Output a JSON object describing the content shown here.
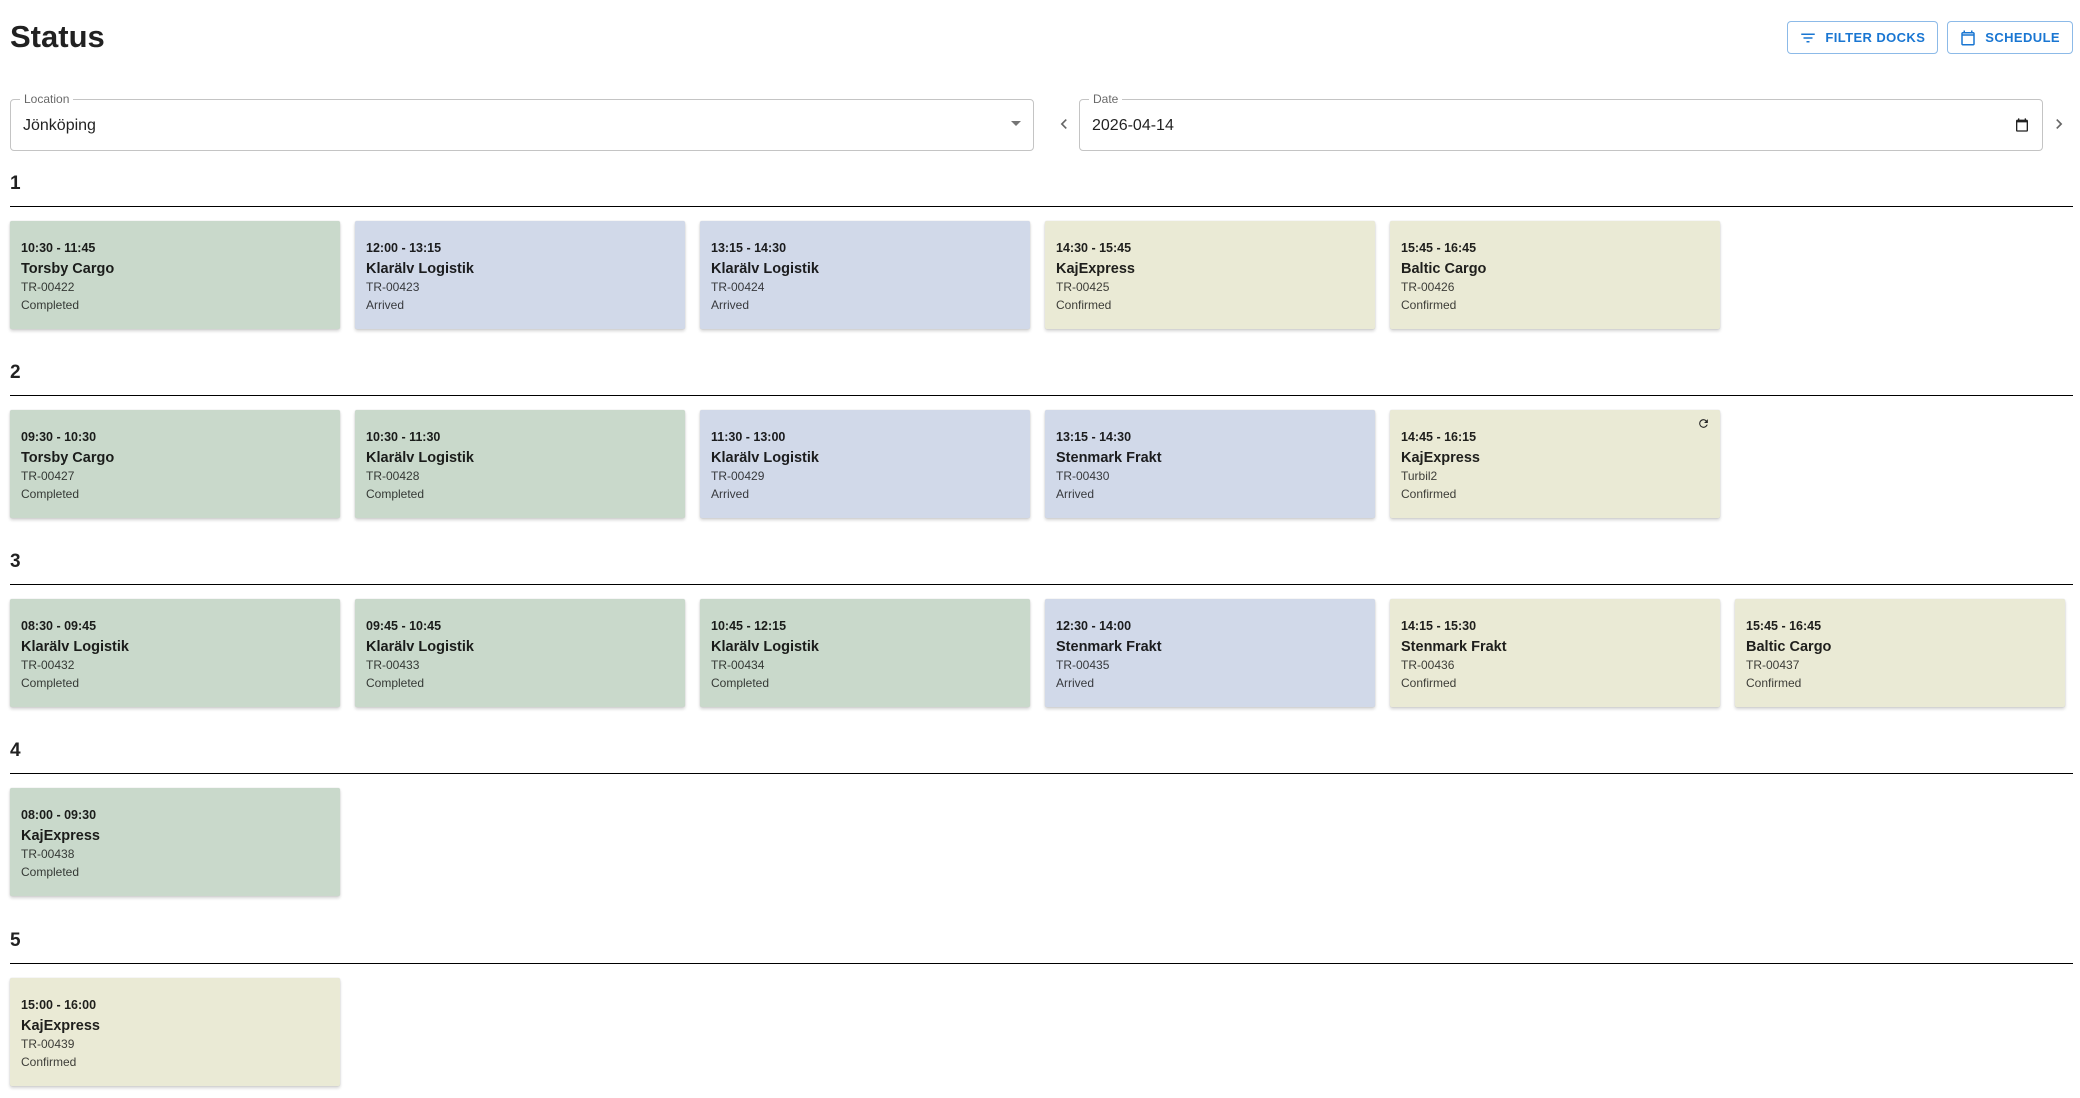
{
  "header": {
    "title": "Status"
  },
  "toolbar": {
    "filter_label": "FILTER DOCKS",
    "schedule_label": "SCHEDULE"
  },
  "filters": {
    "location_label": "Location",
    "location_value": "Jönköping",
    "date_label": "Date",
    "date_value": "2026-04-14"
  },
  "colors": {
    "completed": "#c9d9cb",
    "arrived": "#d1d9e9",
    "confirmed": "#eaead5",
    "accent": "#1976d2"
  },
  "docks": [
    {
      "name": "1",
      "bookings": [
        {
          "time": "10:30 - 11:45",
          "company": "Torsby Cargo",
          "ref": "TR-00422",
          "status": "Completed"
        },
        {
          "time": "12:00 - 13:15",
          "company": "Klarälv Logistik",
          "ref": "TR-00423",
          "status": "Arrived"
        },
        {
          "time": "13:15 - 14:30",
          "company": "Klarälv Logistik",
          "ref": "TR-00424",
          "status": "Arrived"
        },
        {
          "time": "14:30 - 15:45",
          "company": "KajExpress",
          "ref": "TR-00425",
          "status": "Confirmed"
        },
        {
          "time": "15:45 - 16:45",
          "company": "Baltic Cargo",
          "ref": "TR-00426",
          "status": "Confirmed"
        }
      ]
    },
    {
      "name": "2",
      "bookings": [
        {
          "time": "09:30 - 10:30",
          "company": "Torsby Cargo",
          "ref": "TR-00427",
          "status": "Completed"
        },
        {
          "time": "10:30 - 11:30",
          "company": "Klarälv Logistik",
          "ref": "TR-00428",
          "status": "Completed"
        },
        {
          "time": "11:30 - 13:00",
          "company": "Klarälv Logistik",
          "ref": "TR-00429",
          "status": "Arrived"
        },
        {
          "time": "13:15 - 14:30",
          "company": "Stenmark Frakt",
          "ref": "TR-00430",
          "status": "Arrived"
        },
        {
          "time": "14:45 - 16:15",
          "company": "KajExpress",
          "ref": "Turbil2",
          "status": "Confirmed",
          "icon": "refresh-icon"
        }
      ]
    },
    {
      "name": "3",
      "bookings": [
        {
          "time": "08:30 - 09:45",
          "company": "Klarälv Logistik",
          "ref": "TR-00432",
          "status": "Completed"
        },
        {
          "time": "09:45 - 10:45",
          "company": "Klarälv Logistik",
          "ref": "TR-00433",
          "status": "Completed"
        },
        {
          "time": "10:45 - 12:15",
          "company": "Klarälv Logistik",
          "ref": "TR-00434",
          "status": "Completed"
        },
        {
          "time": "12:30 - 14:00",
          "company": "Stenmark Frakt",
          "ref": "TR-00435",
          "status": "Arrived"
        },
        {
          "time": "14:15 - 15:30",
          "company": "Stenmark Frakt",
          "ref": "TR-00436",
          "status": "Confirmed"
        },
        {
          "time": "15:45 - 16:45",
          "company": "Baltic Cargo",
          "ref": "TR-00437",
          "status": "Confirmed"
        }
      ]
    },
    {
      "name": "4",
      "bookings": [
        {
          "time": "08:00 - 09:30",
          "company": "KajExpress",
          "ref": "TR-00438",
          "status": "Completed"
        }
      ]
    },
    {
      "name": "5",
      "bookings": [
        {
          "time": "15:00 - 16:00",
          "company": "KajExpress",
          "ref": "TR-00439",
          "status": "Confirmed"
        }
      ]
    }
  ]
}
